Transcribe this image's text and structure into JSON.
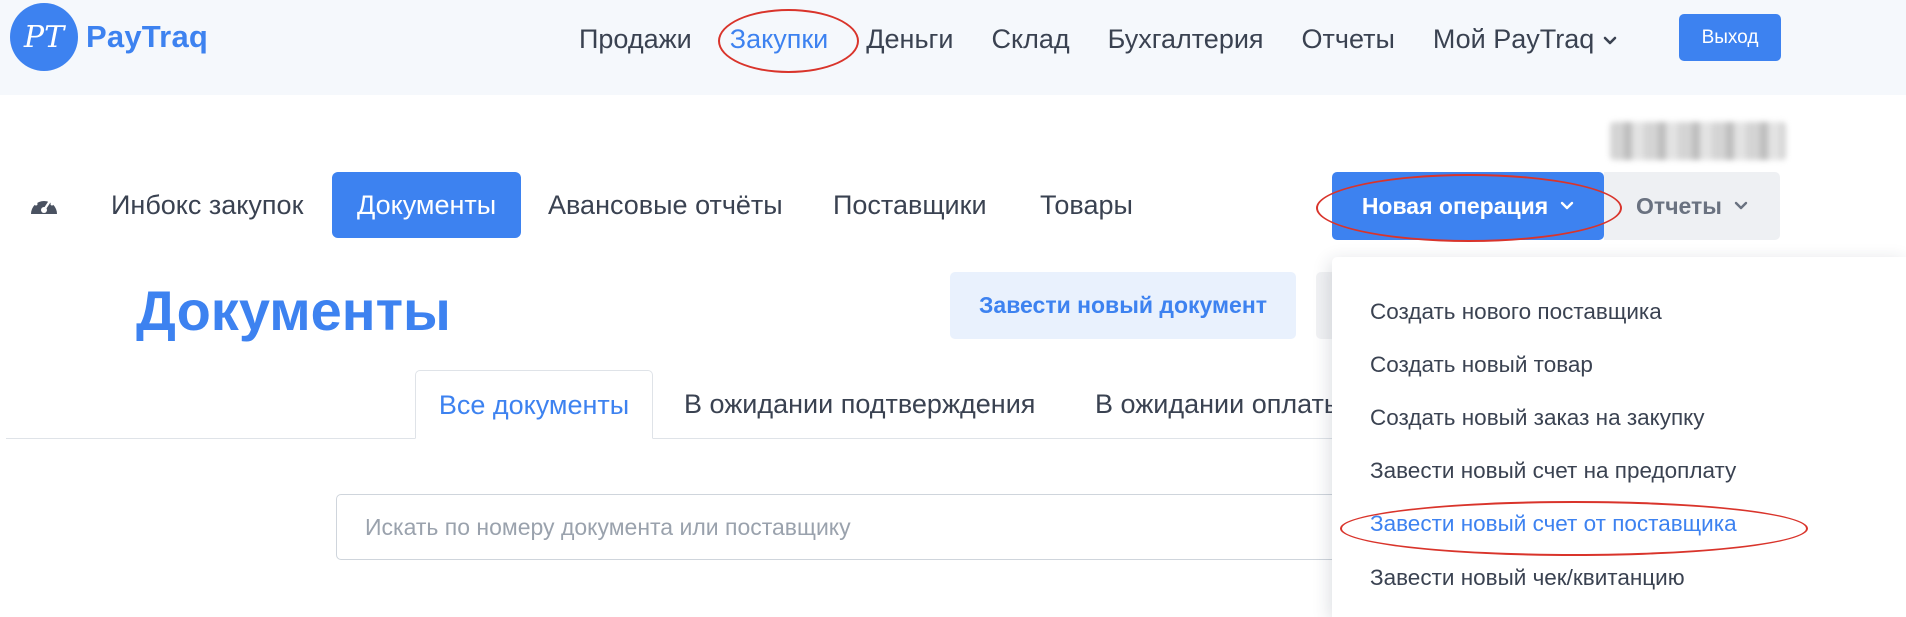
{
  "brand": {
    "logo_monogram": "PT",
    "name": "PayTraq",
    "accent_color": "#3d82f0",
    "highlight_ring_color": "#d9342b"
  },
  "main_nav": {
    "items": [
      {
        "label": "Продажи",
        "active": false
      },
      {
        "label": "Закупки",
        "active": true
      },
      {
        "label": "Деньги",
        "active": false
      },
      {
        "label": "Склад",
        "active": false
      },
      {
        "label": "Бухгалтерия",
        "active": false
      },
      {
        "label": "Отчеты",
        "active": false
      },
      {
        "label": "Мой PayTraq",
        "active": false,
        "has_caret": true
      }
    ],
    "logout_label": "Выход"
  },
  "sub_nav": {
    "dashboard_icon": "dashboard-gauge-icon",
    "items": [
      {
        "label": "Инбокс закупок",
        "active": false
      },
      {
        "label": "Документы",
        "active": true
      },
      {
        "label": "Авансовые отчёты",
        "active": false
      },
      {
        "label": "Поставщики",
        "active": false
      },
      {
        "label": "Товары",
        "active": false
      }
    ],
    "new_operation_label": "Новая операция",
    "reports_label": "Отчеты"
  },
  "page": {
    "title": "Документы",
    "create_document_label": "Завести новый документ"
  },
  "tabs": [
    {
      "label": "Все документы",
      "active": true
    },
    {
      "label": "В ожидании подтверждения",
      "active": false
    },
    {
      "label": "В ожидании оплаты",
      "active": false
    }
  ],
  "search": {
    "placeholder": "Искать по номеру документа или поставщику",
    "value": ""
  },
  "new_operation_menu": {
    "items": [
      {
        "label": "Создать нового поставщика",
        "highlighted": false
      },
      {
        "label": "Создать новый товар",
        "highlighted": false
      },
      {
        "label": "Создать новый заказ на закупку",
        "highlighted": false
      },
      {
        "label": "Завести новый счет на предоплату",
        "highlighted": false
      },
      {
        "label": "Завести новый счет от поставщика",
        "highlighted": true
      },
      {
        "label": "Завести новый чек/квитанцию",
        "highlighted": false
      }
    ]
  }
}
